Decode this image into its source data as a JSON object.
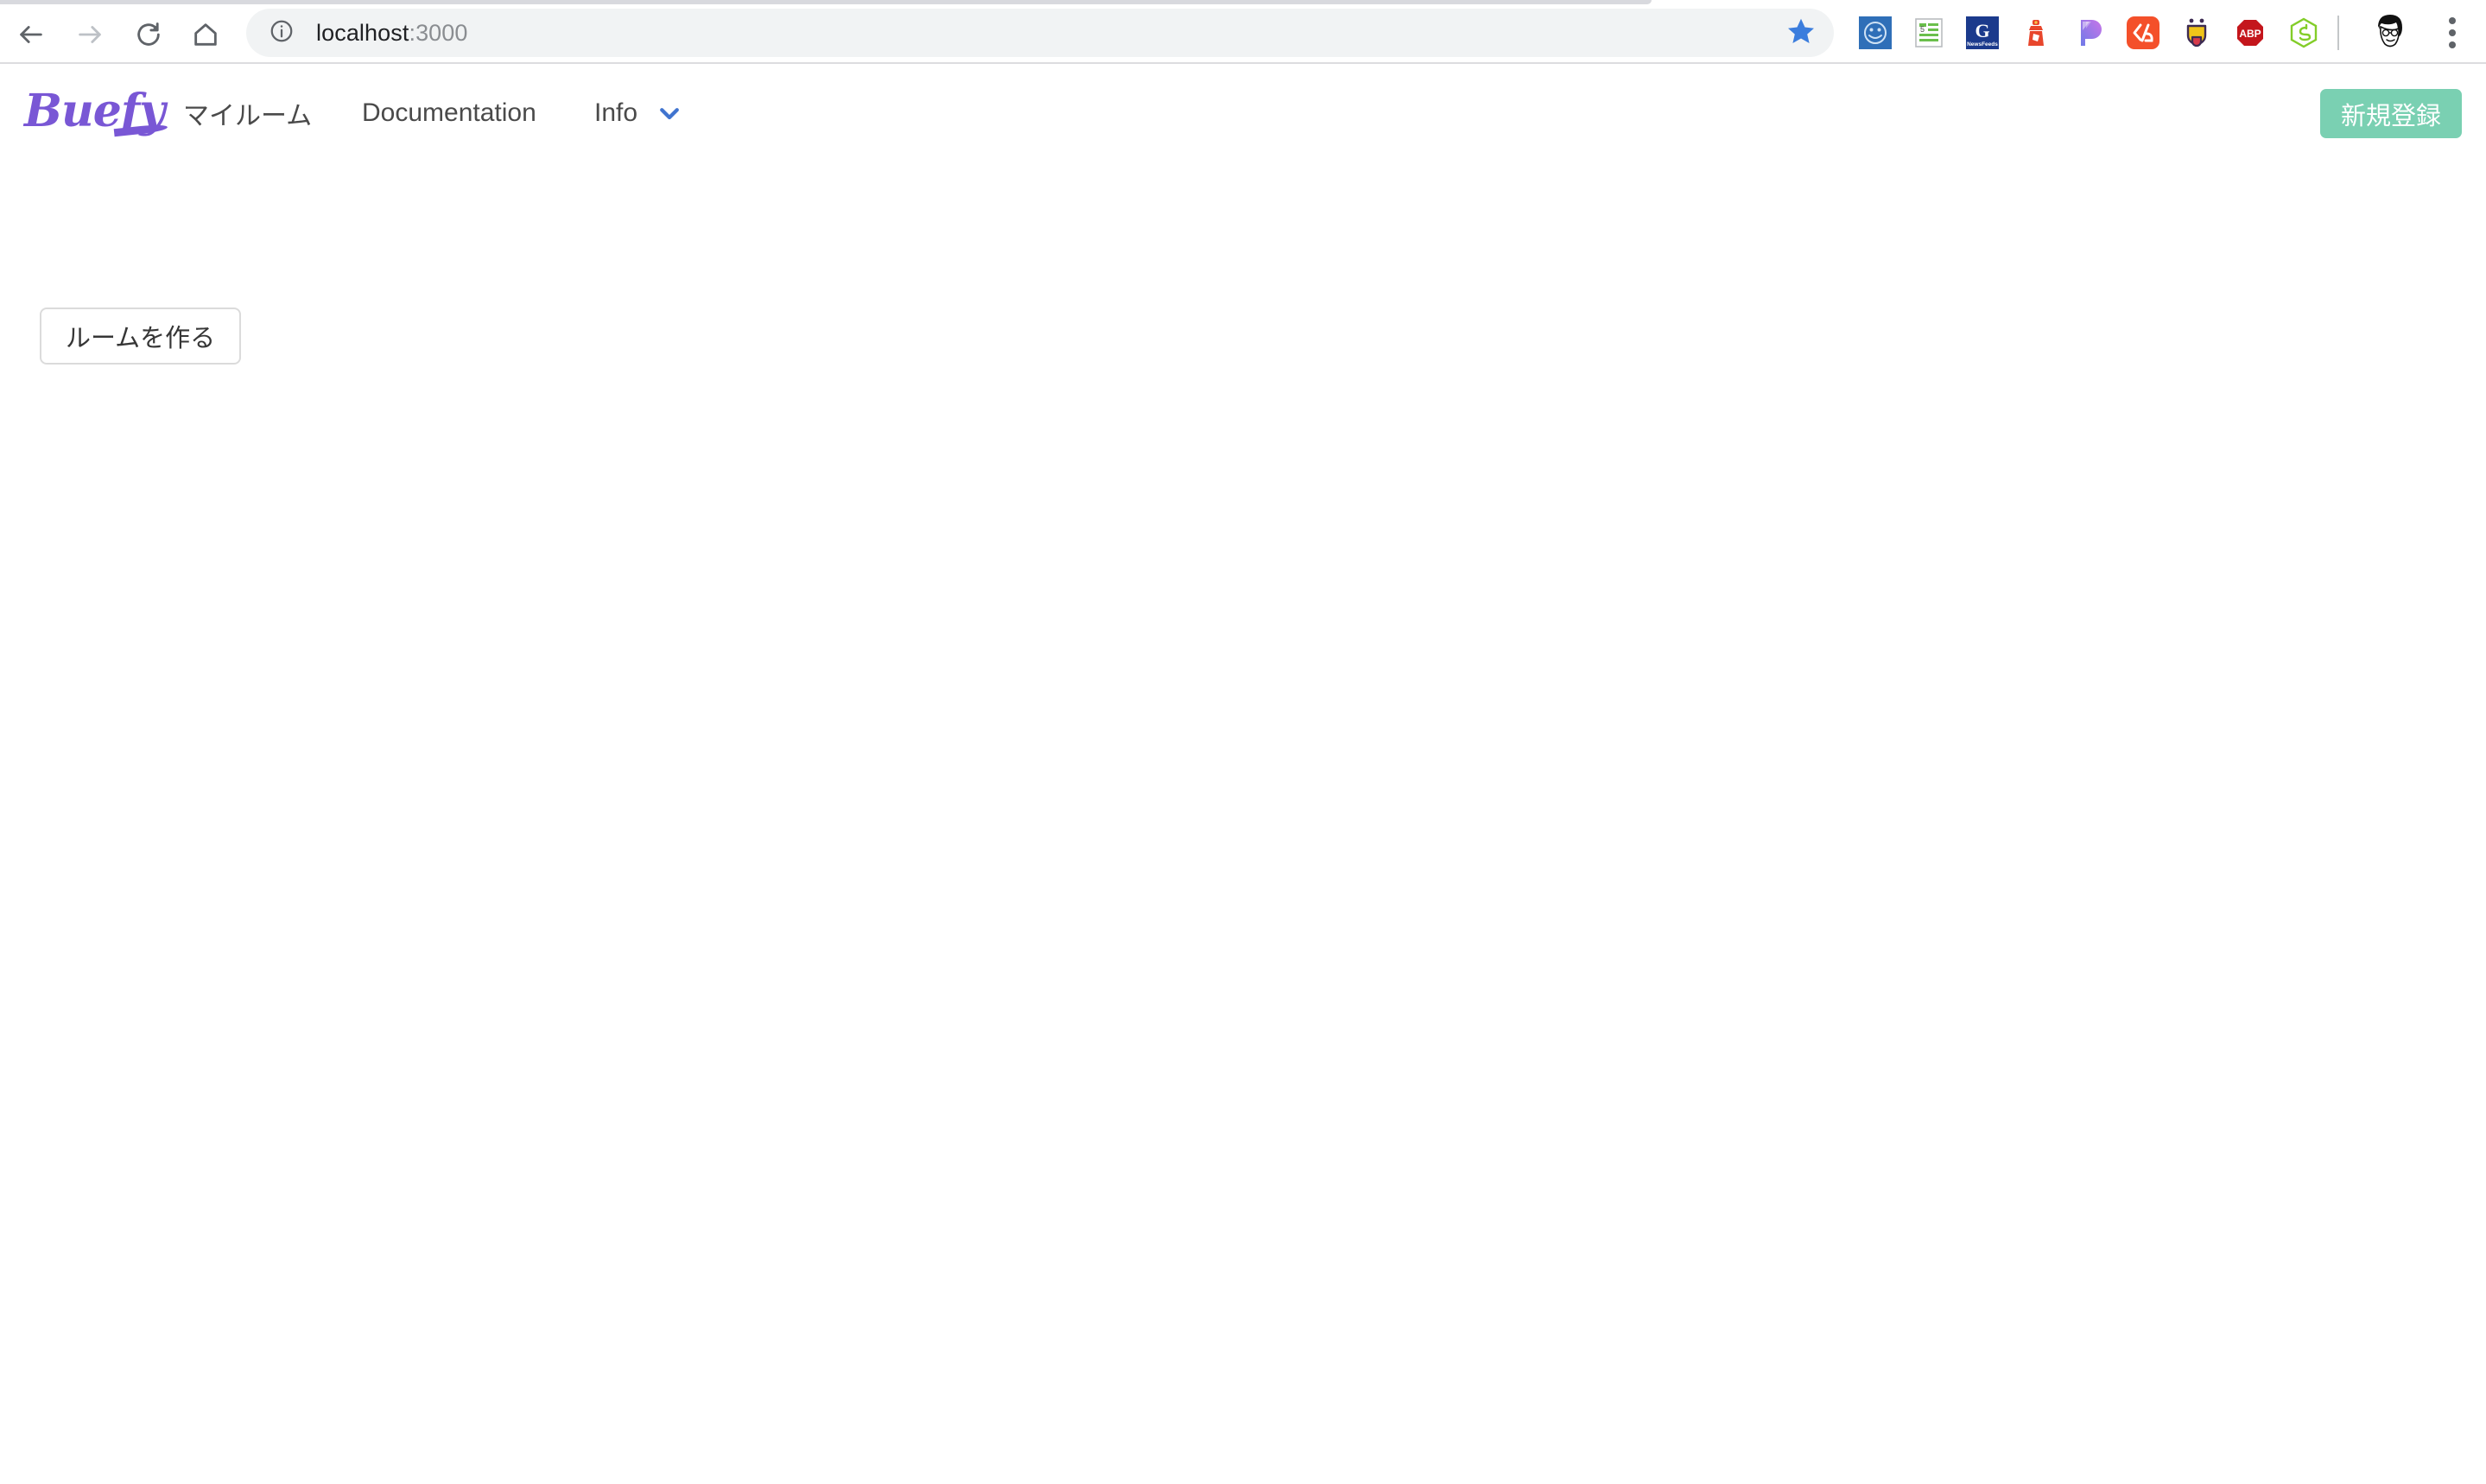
{
  "browser": {
    "back_icon": "back-arrow-icon",
    "forward_icon": "forward-arrow-icon",
    "reload_icon": "reload-icon",
    "home_icon": "home-icon",
    "site_info_icon": "info-circle-icon",
    "url_host": "localhost",
    "url_suffix": ":3000",
    "url_full": "localhost:3000",
    "bookmark_icon": "star-filled-icon",
    "profile_icon": "avatar-icon",
    "menu_icon": "three-dot-menu-icon",
    "extensions": [
      {
        "name": "smiley-face-extension-icon",
        "color": "#2f6fb8"
      },
      {
        "name": "newsfeed-reader-extension-icon",
        "color": "#6abf4b"
      },
      {
        "name": "google-newsfeeds-extension-icon",
        "color": "#1b3a8c"
      },
      {
        "name": "lighthouse-extension-icon",
        "color": "#e8462c"
      },
      {
        "name": "pocket-gradient-extension-icon",
        "color": "#a574e8"
      },
      {
        "name": "code-percent-extension-icon",
        "color": "#f4502a"
      },
      {
        "name": "tongue-face-extension-icon",
        "color": "#f0c419"
      },
      {
        "name": "adblock-plus-extension-icon",
        "color": "#c4161c"
      },
      {
        "name": "nodejs-extension-icon",
        "color": "#83cd29"
      }
    ]
  },
  "site": {
    "brand": "Buefy",
    "brand_color": "#7957d5",
    "nav": [
      {
        "label": "マイルーム",
        "name": "nav-item-myroom"
      },
      {
        "label": "Documentation",
        "name": "nav-item-documentation"
      },
      {
        "label": "Info",
        "name": "nav-item-info",
        "has_chevron": true
      }
    ],
    "chevron_color": "#4074cf",
    "signup_label": "新規登録",
    "signup_color": "#7ad0b2"
  },
  "main": {
    "create_room_label": "ルームを作る"
  }
}
